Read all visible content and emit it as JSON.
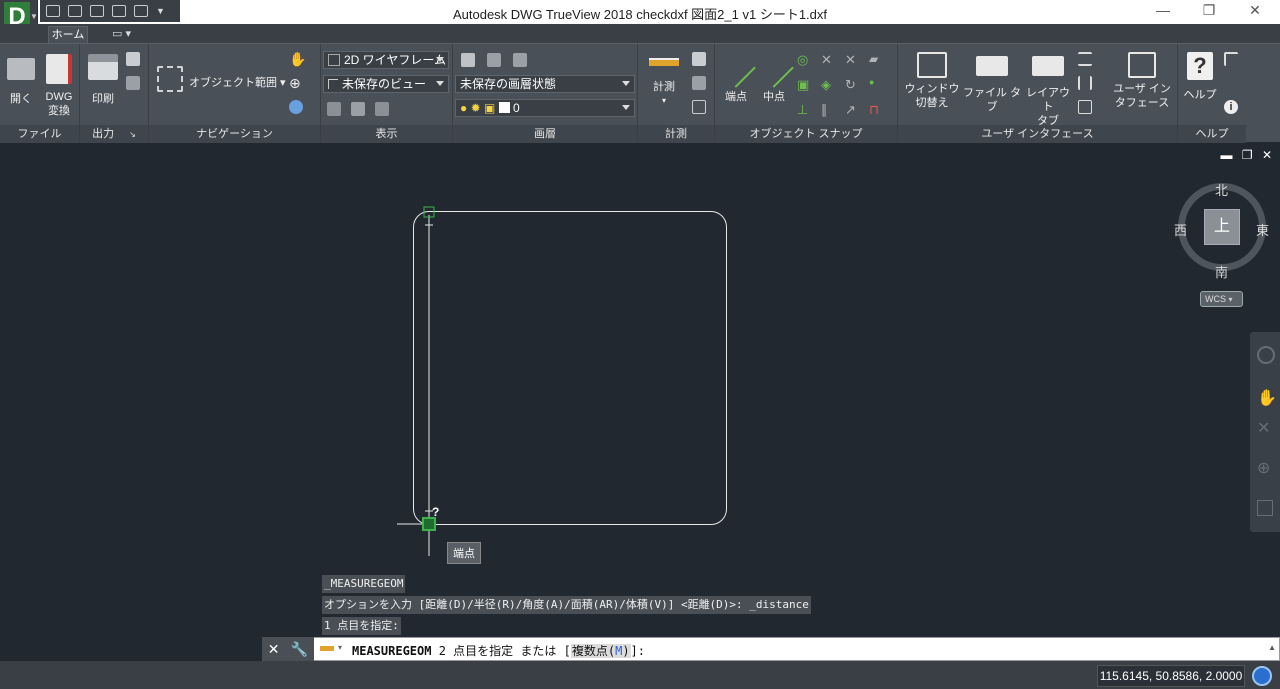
{
  "window": {
    "title": "Autodesk DWG TrueView 2018    checkdxf 図面2_1 v1 シート1.dxf",
    "minimize": "—",
    "restore": "❐",
    "close": "✕"
  },
  "app_button": {
    "letter": "D"
  },
  "tabs": [
    {
      "label": "ホーム",
      "active": true
    }
  ],
  "ribbon": {
    "file_panel": {
      "title": "ファイル",
      "open": "開く",
      "dwg_convert_1": "DWG",
      "dwg_convert_2": "変換"
    },
    "output_panel": {
      "title": "出力",
      "print": "印刷"
    },
    "navigation_panel": {
      "title": "ナビゲーション",
      "extents": "オブジェクト範囲"
    },
    "display_panel": {
      "title": "表示",
      "visual_style": "2D ワイヤフレーム",
      "view": "未保存のビュー"
    },
    "layer_panel": {
      "title": "画層",
      "layer_state": "未保存の画層状態",
      "current_layer": "0"
    },
    "measure_panel": {
      "title": "計測",
      "measure": "計測"
    },
    "osnap_panel": {
      "title": "オブジェクト スナップ",
      "endpoint": "端点",
      "midpoint": "中点"
    },
    "ui_panel": {
      "title": "ユーザ インタフェース",
      "switch_windows_1": "ウィンドウ",
      "switch_windows_2": "切替え",
      "file_tabs": "ファイル タブ",
      "layout_tabs_1": "レイアウト",
      "layout_tabs_2": "タブ",
      "user_interface_1": "ユーザ イン",
      "user_interface_2": "タフェース"
    },
    "help_panel": {
      "title": "ヘルプ",
      "help": "ヘルプ"
    }
  },
  "viewcube": {
    "north": "北",
    "south": "南",
    "east": "東",
    "west": "西",
    "face": "上",
    "wcs": "WCS"
  },
  "drawing": {
    "tooltip": "端点",
    "cursor_label": "?"
  },
  "command_history": [
    "_MEASUREGEOM",
    "オプションを入力 [距離(D)/半径(R)/角度(A)/面積(AR)/体積(V)] <距離(D)>: _distance",
    "1 点目を指定:"
  ],
  "command_line": {
    "command": "MEASUREGEOM",
    "prompt": "2 点目を指定 または [",
    "option_text": "複数点(",
    "option_key": "M",
    "option_close": ")",
    "suffix": "]:"
  },
  "status": {
    "coordinates": "115.6145, 50.8586, 2.0000"
  }
}
